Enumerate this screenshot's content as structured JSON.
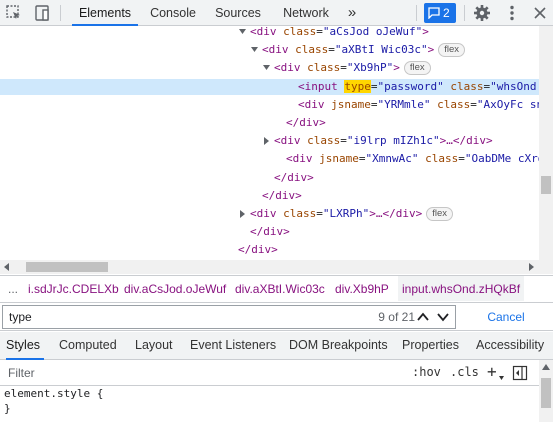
{
  "toolbar": {
    "icons": [
      "inspect-icon",
      "device-toggle-icon",
      "gear-icon",
      "more-icon"
    ],
    "tabs": [
      {
        "label": "Elements",
        "active": true
      },
      {
        "label": "Console",
        "active": false
      },
      {
        "label": "Sources",
        "active": false
      },
      {
        "label": "Network",
        "active": false
      }
    ],
    "more_tabs_label": "»",
    "issues_count": "2"
  },
  "tree": {
    "rows": [
      {
        "indent": 240,
        "tri": "open",
        "tag_open": "<div ",
        "attrs": [
          {
            "name": "class",
            "value": "\"aCsJod oJeWuf\""
          }
        ],
        "tag_close": ">",
        "pill": ""
      },
      {
        "indent": 252,
        "tri": "open",
        "tag_open": "<div ",
        "attrs": [
          {
            "name": "class",
            "value": "\"aXBtI Wic03c\""
          }
        ],
        "tag_close": ">",
        "pill": "flex"
      },
      {
        "indent": 264,
        "tri": "open",
        "tag_open": "<div ",
        "attrs": [
          {
            "name": "class",
            "value": "\"Xb9hP\""
          }
        ],
        "tag_close": ">",
        "pill": "flex"
      },
      {
        "indent": 288,
        "tri": "",
        "selected": true,
        "tag_open": "<input ",
        "attrs": [
          {
            "name": "type",
            "value": "\"password\"",
            "highlight": true
          },
          {
            "name": "class",
            "value": "\"whsOnd zH"
          }
        ],
        "tag_close": "",
        "pill": ""
      },
      {
        "indent": 288,
        "tri": "",
        "tag_open": "<div ",
        "attrs": [
          {
            "name": "jsname",
            "value": "\"YRMmle\""
          },
          {
            "name": "class",
            "value": "\"AxOyFc snBy"
          }
        ],
        "tag_close": "",
        "pill": ""
      },
      {
        "indent": 276,
        "tri": "",
        "tag_open": "</div>",
        "attrs": [],
        "tag_close": "",
        "pill": ""
      },
      {
        "indent": 264,
        "tri": "closed",
        "tag_open": "<div ",
        "attrs": [
          {
            "name": "class",
            "value": "\"i9lrp mIZh1c\""
          }
        ],
        "tag_close": ">…</div>",
        "pill": ""
      },
      {
        "indent": 276,
        "tri": "",
        "tag_open": "<div ",
        "attrs": [
          {
            "name": "jsname",
            "value": "\"XmnwAc\""
          },
          {
            "name": "class",
            "value": "\"OabDMe cXrdq"
          }
        ],
        "tag_close": "",
        "pill": ""
      },
      {
        "indent": 264,
        "tri": "",
        "tag_open": "</div>",
        "attrs": [],
        "tag_close": "",
        "pill": ""
      },
      {
        "indent": 252,
        "tri": "",
        "tag_open": "</div>",
        "attrs": [],
        "tag_close": "",
        "pill": ""
      },
      {
        "indent": 240,
        "tri": "closed",
        "tag_open": "<div ",
        "attrs": [
          {
            "name": "class",
            "value": "\"LXRPh\""
          }
        ],
        "tag_close": ">…</div>",
        "pill": "flex"
      },
      {
        "indent": 240,
        "tri": "",
        "tag_open": "</div>",
        "attrs": [],
        "tag_close": "",
        "pill": ""
      },
      {
        "indent": 228,
        "tri": "",
        "tag_open": "</div>",
        "attrs": [],
        "tag_close": "",
        "pill": ""
      },
      {
        "indent": 216,
        "tri": "",
        "tag_open": "</div>",
        "attrs": [],
        "tag_close": "",
        "pill": ""
      }
    ]
  },
  "breadcrumb": {
    "ellipsis": "...",
    "items": [
      {
        "label": "i.sdJrJc.CDELXb",
        "active": false
      },
      {
        "label": "div.aCsJod.oJeWuf",
        "active": false
      },
      {
        "label": "div.aXBtI.Wic03c",
        "active": false
      },
      {
        "label": "div.Xb9hP",
        "active": false
      },
      {
        "label": "input.whsOnd.zHQkBf",
        "active": true
      }
    ]
  },
  "search": {
    "value": "type",
    "match_count": "9 of 21",
    "cancel_label": "Cancel"
  },
  "style_tabs": [
    {
      "label": "Styles",
      "active": true
    },
    {
      "label": "Computed",
      "active": false
    },
    {
      "label": "Layout",
      "active": false
    },
    {
      "label": "Event Listeners",
      "active": false
    },
    {
      "label": "DOM Breakpoints",
      "active": false
    },
    {
      "label": "Properties",
      "active": false
    },
    {
      "label": "Accessibility",
      "active": false
    }
  ],
  "filter": {
    "placeholder": "Filter",
    "hov_label": ":hov",
    "cls_label": ".cls",
    "add_label": "+"
  },
  "styles": {
    "line1": "element.style {",
    "line2": "}"
  },
  "colors": {
    "accent": "#1a73e8",
    "tag": "#881280",
    "attr": "#994500",
    "value": "#1a1aa6",
    "selected_row": "#cfe8fc",
    "highlight": "#ffd600"
  }
}
